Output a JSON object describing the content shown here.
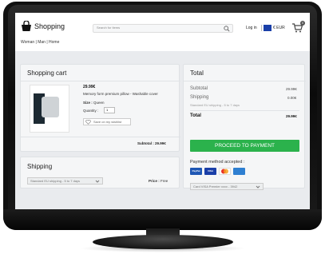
{
  "header": {
    "logo_text": "Shopping",
    "search_placeholder": "Search for items",
    "login_label": "Log in",
    "currency_label": "€ EUR",
    "cart_count": "0"
  },
  "nav": {
    "breadcrumb": "Woman | Man | Home"
  },
  "cart": {
    "title": "Shopping cart",
    "item": {
      "price": "29.99€",
      "name": "Memory form premium pillow - Washable cover",
      "size_label": "Size :",
      "size_value": "Queen",
      "qty_label": "Quantity :",
      "qty_value": "1",
      "wishlist_label": "Save on my wishlist"
    },
    "subtotal": "Subtotal : 29.99€"
  },
  "shipping": {
    "title": "Shipping",
    "method": "Standard EU shipping - 5 to 7 days",
    "price_label": "Price :",
    "price_value": "Free"
  },
  "total": {
    "title": "Total",
    "subtotal_label": "Subtotal",
    "subtotal_value": "29.99€",
    "shipping_label": "Shipping",
    "shipping_value": "0.00€",
    "shipping_note": "Standard EU shipping - 5 to 7 days",
    "total_label": "Total",
    "total_value": "29.99€",
    "proceed_label": "PROCEED TO PAYMENT",
    "payment_label": "Payment method accepted :",
    "payment_methods": [
      "PayPal",
      "VISA",
      "Mastercard",
      "Amex"
    ],
    "card_select": "Card VISA Premier xxxx - 3942"
  },
  "colors": {
    "accent": "#2bb24c",
    "flag": "#1a3fa8"
  }
}
